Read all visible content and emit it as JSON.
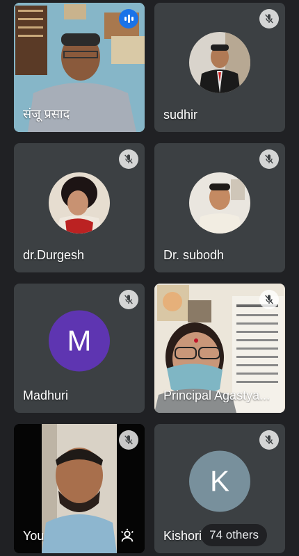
{
  "participants": [
    {
      "name": "संजू प्रसाद",
      "type": "video",
      "status": "speaking"
    },
    {
      "name": "sudhir",
      "type": "photo",
      "status": "muted"
    },
    {
      "name": "dr.Durgesh",
      "type": "photo",
      "status": "muted"
    },
    {
      "name": "Dr. subodh",
      "type": "photo",
      "status": "muted"
    },
    {
      "name": "Madhuri",
      "type": "letter",
      "letter": "M",
      "avatar_color": "#5e35b1",
      "status": "muted"
    },
    {
      "name": "Principal Agastya...",
      "type": "video",
      "status": "muted"
    },
    {
      "name": "You",
      "type": "video",
      "status": "muted"
    },
    {
      "name": "Kishori",
      "type": "letter",
      "letter": "K",
      "avatar_color": "#78909c",
      "status": "muted"
    }
  ],
  "others_label": "74 others",
  "colors": {
    "background": "#202124",
    "tile": "#3c4043",
    "speaking": "#1a73e8"
  }
}
